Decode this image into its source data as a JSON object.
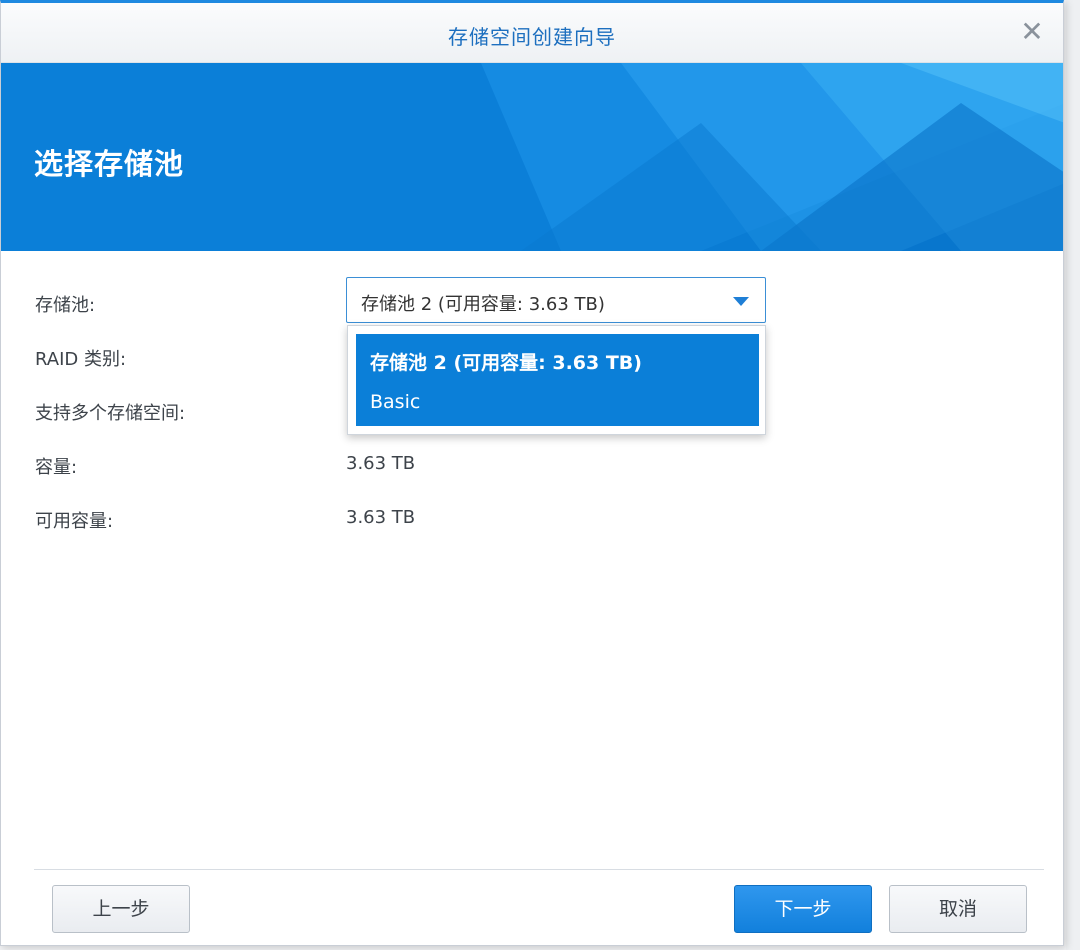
{
  "dialog": {
    "title": "存储空间创建向导",
    "close_icon": "close-icon"
  },
  "banner": {
    "heading": "选择存储池",
    "background_color": "#0b7fd8"
  },
  "fields": [
    {
      "label": "存储池:"
    },
    {
      "label": "RAID 类别:"
    },
    {
      "label": "支持多个存储空间:"
    },
    {
      "label": "容量:",
      "value": "3.63 TB"
    },
    {
      "label": "可用容量:",
      "value": "3.63 TB"
    }
  ],
  "storage_pool_select": {
    "selected": "存储池 2 (可用容量: 3.63 TB)",
    "caret_icon": "caret-down-icon",
    "options": [
      {
        "label": "存储池 2 (可用容量: 3.63 TB)"
      },
      {
        "label": "Basic"
      }
    ]
  },
  "buttons": {
    "prev": "上一步",
    "next": "下一步",
    "cancel": "取消"
  },
  "colors": {
    "accent": "#0b7fd8",
    "title_text": "#1d6fbf",
    "primary_button": "#1280dc"
  }
}
